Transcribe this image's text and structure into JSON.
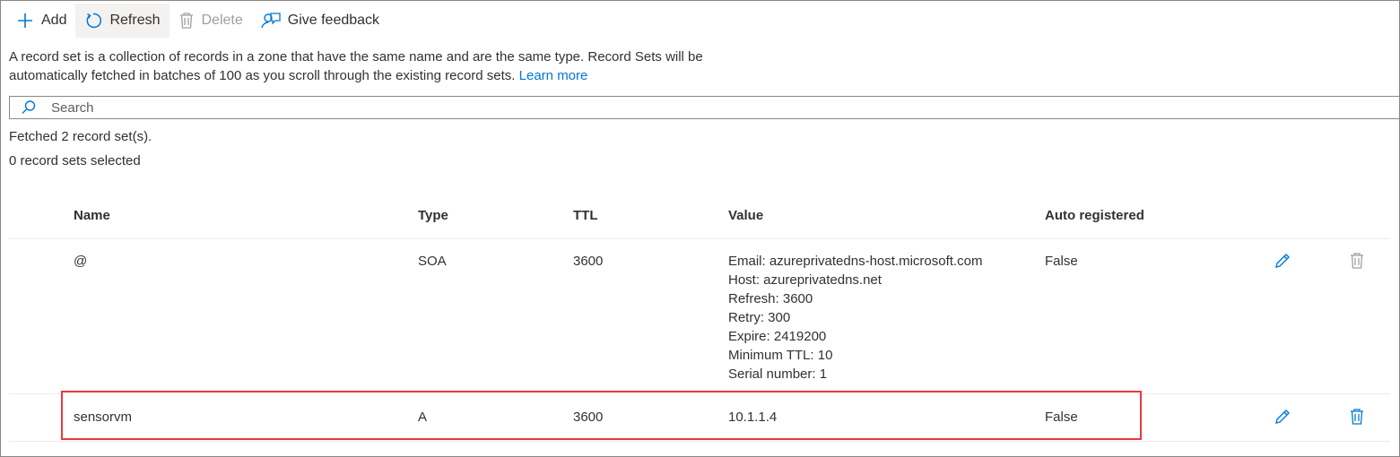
{
  "toolbar": {
    "add_label": "Add",
    "refresh_label": "Refresh",
    "delete_label": "Delete",
    "feedback_label": "Give feedback"
  },
  "description": {
    "text": "A record set is a collection of records in a zone that have the same name and are the same type. Record Sets will be automatically fetched in batches of 100 as you scroll through the existing record sets.",
    "link": "Learn more"
  },
  "search": {
    "placeholder": "Search"
  },
  "status": {
    "fetched": "Fetched 2 record set(s).",
    "selected": "0 record sets selected"
  },
  "table": {
    "columns": [
      "Name",
      "Type",
      "TTL",
      "Value",
      "Auto registered"
    ],
    "rows": [
      {
        "name": "@",
        "type": "SOA",
        "ttl": "3600",
        "value": [
          "Email: azureprivatedns-host.microsoft.com",
          "Host: azureprivatedns.net",
          "Refresh: 3600",
          "Retry: 300",
          "Expire: 2419200",
          "Minimum TTL: 10",
          "Serial number: 1"
        ],
        "auto_registered": "False",
        "delete_enabled": false
      },
      {
        "name": "sensorvm",
        "type": "A",
        "ttl": "3600",
        "value": [
          "10.1.1.4"
        ],
        "auto_registered": "False",
        "delete_enabled": true
      }
    ]
  },
  "colors": {
    "accent": "#0078d4",
    "highlight": "#e8393f",
    "disabled": "#a19f9d"
  }
}
